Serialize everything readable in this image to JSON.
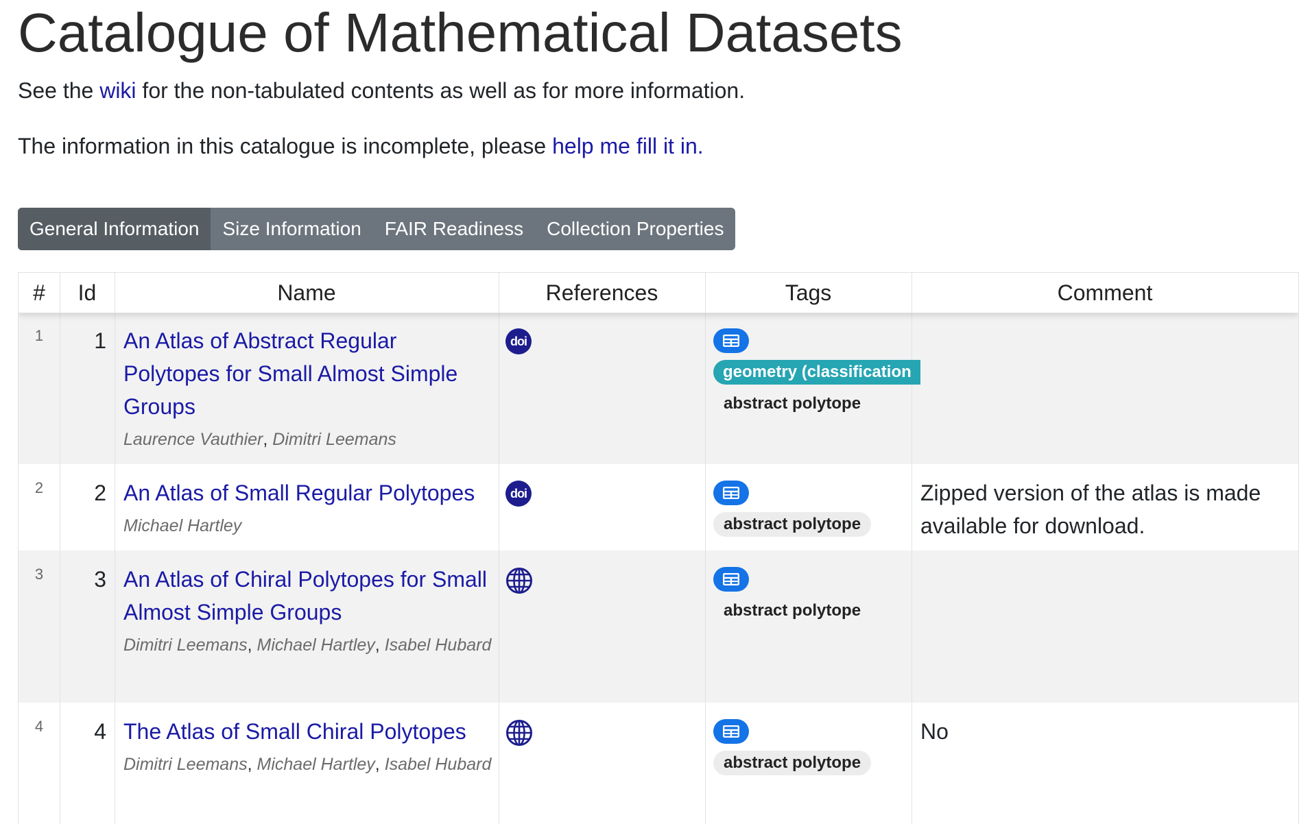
{
  "page": {
    "title": "Catalogue of Mathematical Datasets",
    "intro1": {
      "before": "See the ",
      "link": "wiki",
      "after": " for the non-tabulated contents as well as for more information."
    },
    "intro2": {
      "before": "The information in this catalogue is incomplete, please ",
      "link": "help me fill it in."
    }
  },
  "tabs": [
    {
      "label": "General Information",
      "active": true
    },
    {
      "label": "Size Information",
      "active": false
    },
    {
      "label": "FAIR Readiness",
      "active": false
    },
    {
      "label": "Collection Properties",
      "active": false
    }
  ],
  "table": {
    "headers": [
      "#",
      "Id",
      "Name",
      "References",
      "Tags",
      "Comment"
    ],
    "rows": [
      {
        "num": "1",
        "id": "1",
        "name": "An Atlas of Abstract Regular Polytopes for Small Almost Simple Groups",
        "authors": [
          "Laurence Vauthier",
          "Dimitri Leemans"
        ],
        "ref_icon": "doi-icon",
        "ref_label": "doi",
        "tags": [
          "table-icon",
          "geometry (classification",
          "abstract polytope"
        ],
        "comment": ""
      },
      {
        "num": "2",
        "id": "2",
        "name": "An Atlas of Small Regular Polytopes",
        "authors": [
          "Michael Hartley"
        ],
        "ref_icon": "doi-icon",
        "ref_label": "doi",
        "tags": [
          "table-icon",
          "abstract polytope"
        ],
        "comment": "Zipped version of the atlas is made available for download."
      },
      {
        "num": "3",
        "id": "3",
        "name": "An Atlas of Chiral Polytopes for Small Almost Simple Groups",
        "authors": [
          "Dimitri Leemans",
          "Michael Hartley",
          "Isabel Hubard"
        ],
        "ref_icon": "globe-icon",
        "ref_label": "",
        "tags": [
          "table-icon",
          "abstract polytope"
        ],
        "comment": ""
      },
      {
        "num": "4",
        "id": "4",
        "name": "The Atlas of Small Chiral Polytopes",
        "authors": [
          "Dimitri Leemans",
          "Michael Hartley",
          "Isabel Hubard"
        ],
        "ref_icon": "globe-icon",
        "ref_label": "",
        "tags": [
          "table-icon",
          "abstract polytope"
        ],
        "comment": "No"
      }
    ]
  },
  "colors": {
    "link": "#1a1aa6",
    "tab_bg": "#6c757d",
    "tab_active": "#565e64",
    "tag_table": "#1473e6",
    "tag_geometry": "#26a5b3",
    "doi": "#1d1d8e"
  }
}
